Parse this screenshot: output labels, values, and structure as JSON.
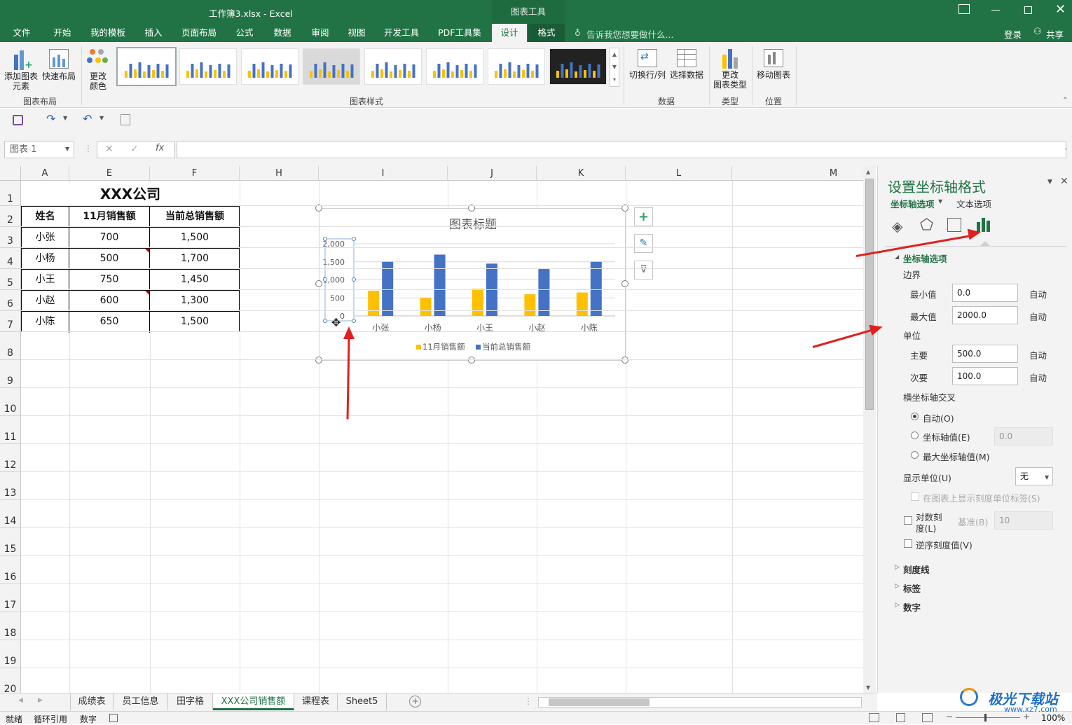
{
  "window": {
    "title": "工作簿3.xlsx - Excel",
    "context_tab": "图表工具",
    "login": "登录",
    "share": "共享"
  },
  "tabs": [
    "文件",
    "开始",
    "我的模板",
    "插入",
    "页面布局",
    "公式",
    "数据",
    "审阅",
    "视图",
    "开发工具",
    "PDF工具集",
    "设计",
    "格式"
  ],
  "tell_me": "告诉我您想要做什么...",
  "ribbon": {
    "add_element": "添加图表元素",
    "add_element_line1": "添加图表",
    "add_element_line2": "元素",
    "quick_layout": "快速布局",
    "group_layout": "图表布局",
    "change_color_line1": "更改",
    "change_color_line2": "颜色",
    "group_styles": "图表样式",
    "switch_rowcol": "切换行/列",
    "select_data": "选择数据",
    "group_data": "数据",
    "change_type_line1": "更改",
    "change_type_line2": "图表类型",
    "group_type": "类型",
    "move_chart": "移动图表",
    "group_location": "位置"
  },
  "formula_bar": {
    "name_box": "图表 1",
    "fx": "fx"
  },
  "columns": [
    "A",
    "E",
    "F",
    "H",
    "I",
    "J",
    "K",
    "L",
    "M"
  ],
  "rows": [
    "1",
    "2",
    "3",
    "4",
    "5",
    "6",
    "7",
    "8",
    "9",
    "10",
    "11",
    "12",
    "13",
    "14",
    "15",
    "16",
    "17",
    "18",
    "19",
    "20"
  ],
  "table": {
    "title": "XXX公司",
    "headers": [
      "姓名",
      "11月销售额",
      "当前总销售额"
    ],
    "rows": [
      [
        "小张",
        "700",
        "1,500"
      ],
      [
        "小杨",
        "500",
        "1,700"
      ],
      [
        "小王",
        "750",
        "1,450"
      ],
      [
        "小赵",
        "600",
        "1,300"
      ],
      [
        "小陈",
        "650",
        "1,500"
      ]
    ]
  },
  "chart_data": {
    "type": "bar",
    "title": "图表标题",
    "categories": [
      "小张",
      "小杨",
      "小王",
      "小赵",
      "小陈"
    ],
    "series": [
      {
        "name": "11月销售额",
        "values": [
          700,
          500,
          750,
          600,
          650
        ],
        "color": "#ffc000"
      },
      {
        "name": "当前总销售额",
        "values": [
          1500,
          1700,
          1450,
          1300,
          1500
        ],
        "color": "#4472c4"
      }
    ],
    "yticks": [
      "0",
      "500",
      "1,000",
      "1,500",
      "2,000"
    ],
    "ylim": [
      0,
      2000
    ],
    "legend": "bottom",
    "grid": true
  },
  "pane": {
    "title": "设置坐标轴格式",
    "tab_axis": "坐标轴选项",
    "tab_text": "文本选项",
    "section": "坐标轴选项",
    "bounds": "边界",
    "min_label": "最小值",
    "min_value": "0.0",
    "max_label": "最大值",
    "max_value": "2000.0",
    "auto": "自动",
    "units": "单位",
    "major_label": "主要",
    "major_value": "500.0",
    "minor_label": "次要",
    "minor_value": "100.0",
    "cross_label": "横坐标轴交叉",
    "cross_auto": "自动(O)",
    "cross_value": "坐标轴值(E)",
    "cross_value_input": "0.0",
    "cross_max": "最大坐标轴值(M)",
    "display_units": "显示单位(U)",
    "display_units_value": "无",
    "show_units_label": "在图表上显示刻度单位标签(S)",
    "log_scale_1": "对数刻",
    "log_scale_2": "度(L)",
    "base_label": "基准(B)",
    "base_value": "10",
    "reverse": "逆序刻度值(V)",
    "tick_marks": "刻度线",
    "labels": "标签",
    "number": "数字"
  },
  "sheet_tabs": [
    "成绩表",
    "员工信息",
    "田字格",
    "XXX公司销售额",
    "课程表",
    "Sheet5"
  ],
  "status": {
    "ready": "就绪",
    "circular": "循环引用",
    "mode": "数字",
    "zoom": "100%"
  },
  "watermark": {
    "name": "极光下载站",
    "url": "www.xz7.com"
  }
}
